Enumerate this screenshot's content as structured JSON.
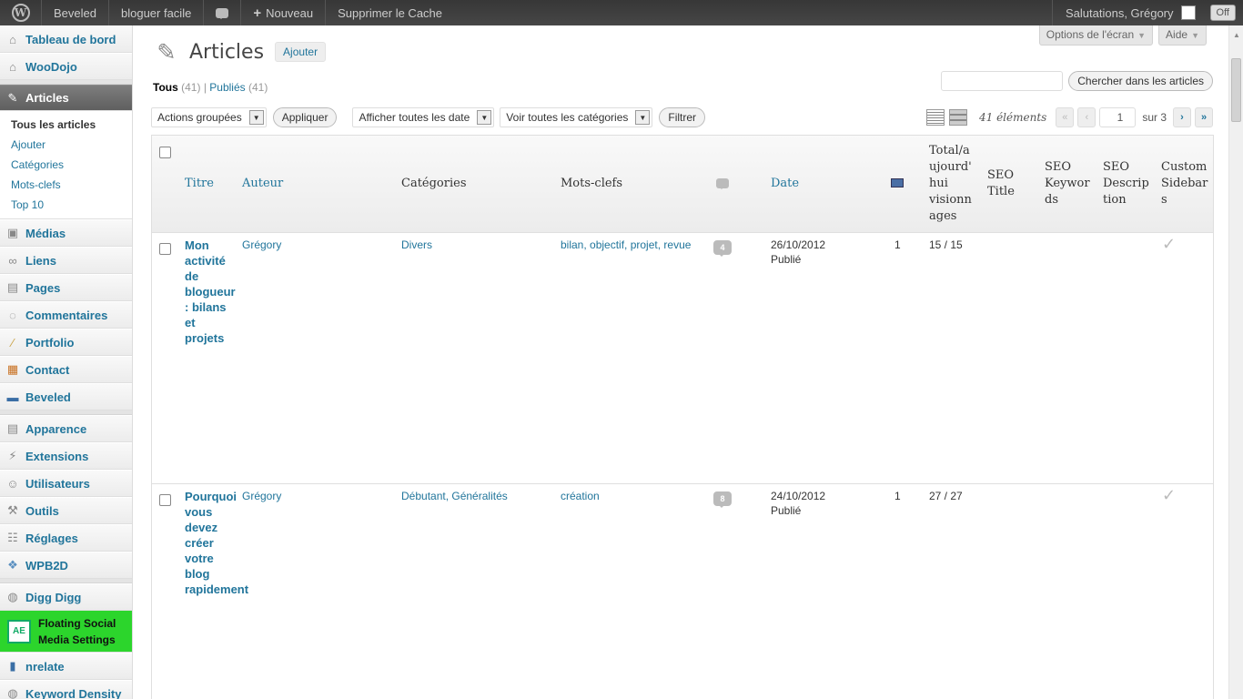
{
  "adminbar": {
    "site_name": "Beveled",
    "blog_link": "bloguer facile",
    "new_label": "Nouveau",
    "cache_label": "Supprimer le Cache",
    "greeting": "Salutations, Grégory",
    "toggle": "Off"
  },
  "sidebar": {
    "items": [
      {
        "label": "Tableau de bord",
        "icon": "dashboard-icon"
      },
      {
        "label": "WooDojo",
        "icon": "woodojo-icon"
      },
      {
        "label": "Articles",
        "icon": "pin-icon"
      }
    ],
    "submenu": [
      "Tous les articles",
      "Ajouter",
      "Catégories",
      "Mots-clefs",
      "Top 10"
    ],
    "items2": [
      {
        "label": "Médias"
      },
      {
        "label": "Liens"
      },
      {
        "label": "Pages"
      },
      {
        "label": "Commentaires"
      },
      {
        "label": "Portfolio"
      },
      {
        "label": "Contact"
      },
      {
        "label": "Beveled"
      }
    ],
    "items3": [
      {
        "label": "Apparence"
      },
      {
        "label": "Extensions"
      },
      {
        "label": "Utilisateurs"
      },
      {
        "label": "Outils"
      },
      {
        "label": "Réglages"
      },
      {
        "label": "WPB2D"
      }
    ],
    "items4": [
      {
        "label": "Digg Digg"
      },
      {
        "label": "Floating Social Media Settings"
      },
      {
        "label": "nrelate"
      },
      {
        "label": "Keyword Density"
      }
    ]
  },
  "screen": {
    "options": "Options de l'écran",
    "help": "Aide"
  },
  "page": {
    "title": "Articles",
    "add_new": "Ajouter",
    "view_all": "Tous",
    "view_all_count": "(41)",
    "view_sep": "|",
    "view_published": "Publiés",
    "view_published_count": "(41)"
  },
  "search": {
    "button": "Chercher dans les articles"
  },
  "tablenav": {
    "bulk": "Actions groupées",
    "apply": "Appliquer",
    "dates": "Afficher toutes les date",
    "categories": "Voir toutes les catégories",
    "filter": "Filtrer",
    "count": "41 éléments",
    "first": "«",
    "prev": "‹",
    "current_page": "1",
    "of_pages": "sur 3",
    "next": "›",
    "last": "»"
  },
  "table": {
    "columns": {
      "title": "Titre",
      "author": "Auteur",
      "categories": "Catégories",
      "tags": "Mots-clefs",
      "date": "Date",
      "views": "Total/a ujourd' hui visionn ages",
      "seo_title": "SEO Title",
      "seo_keywords": "SEO Keywor ds",
      "seo_desc": "SEO Descrip tion",
      "sidebars": "Custom Sidebar s"
    },
    "rows": [
      {
        "title": "Mon activité de blogueur : bilans et projets",
        "author": "Grégory",
        "categories": "Divers",
        "tags": "bilan, objectif, projet, revue",
        "comments": "4",
        "date": "26/10/2012",
        "status": "Publié",
        "mail": "1",
        "views": "15 / 15"
      },
      {
        "title": "Pourquoi vous devez créer votre blog rapidement",
        "author": "Grégory",
        "categories": "Débutant, Généralités",
        "tags": "création",
        "comments": "8",
        "date": "24/10/2012",
        "status": "Publié",
        "mail": "1",
        "views": "27 / 27"
      }
    ]
  }
}
